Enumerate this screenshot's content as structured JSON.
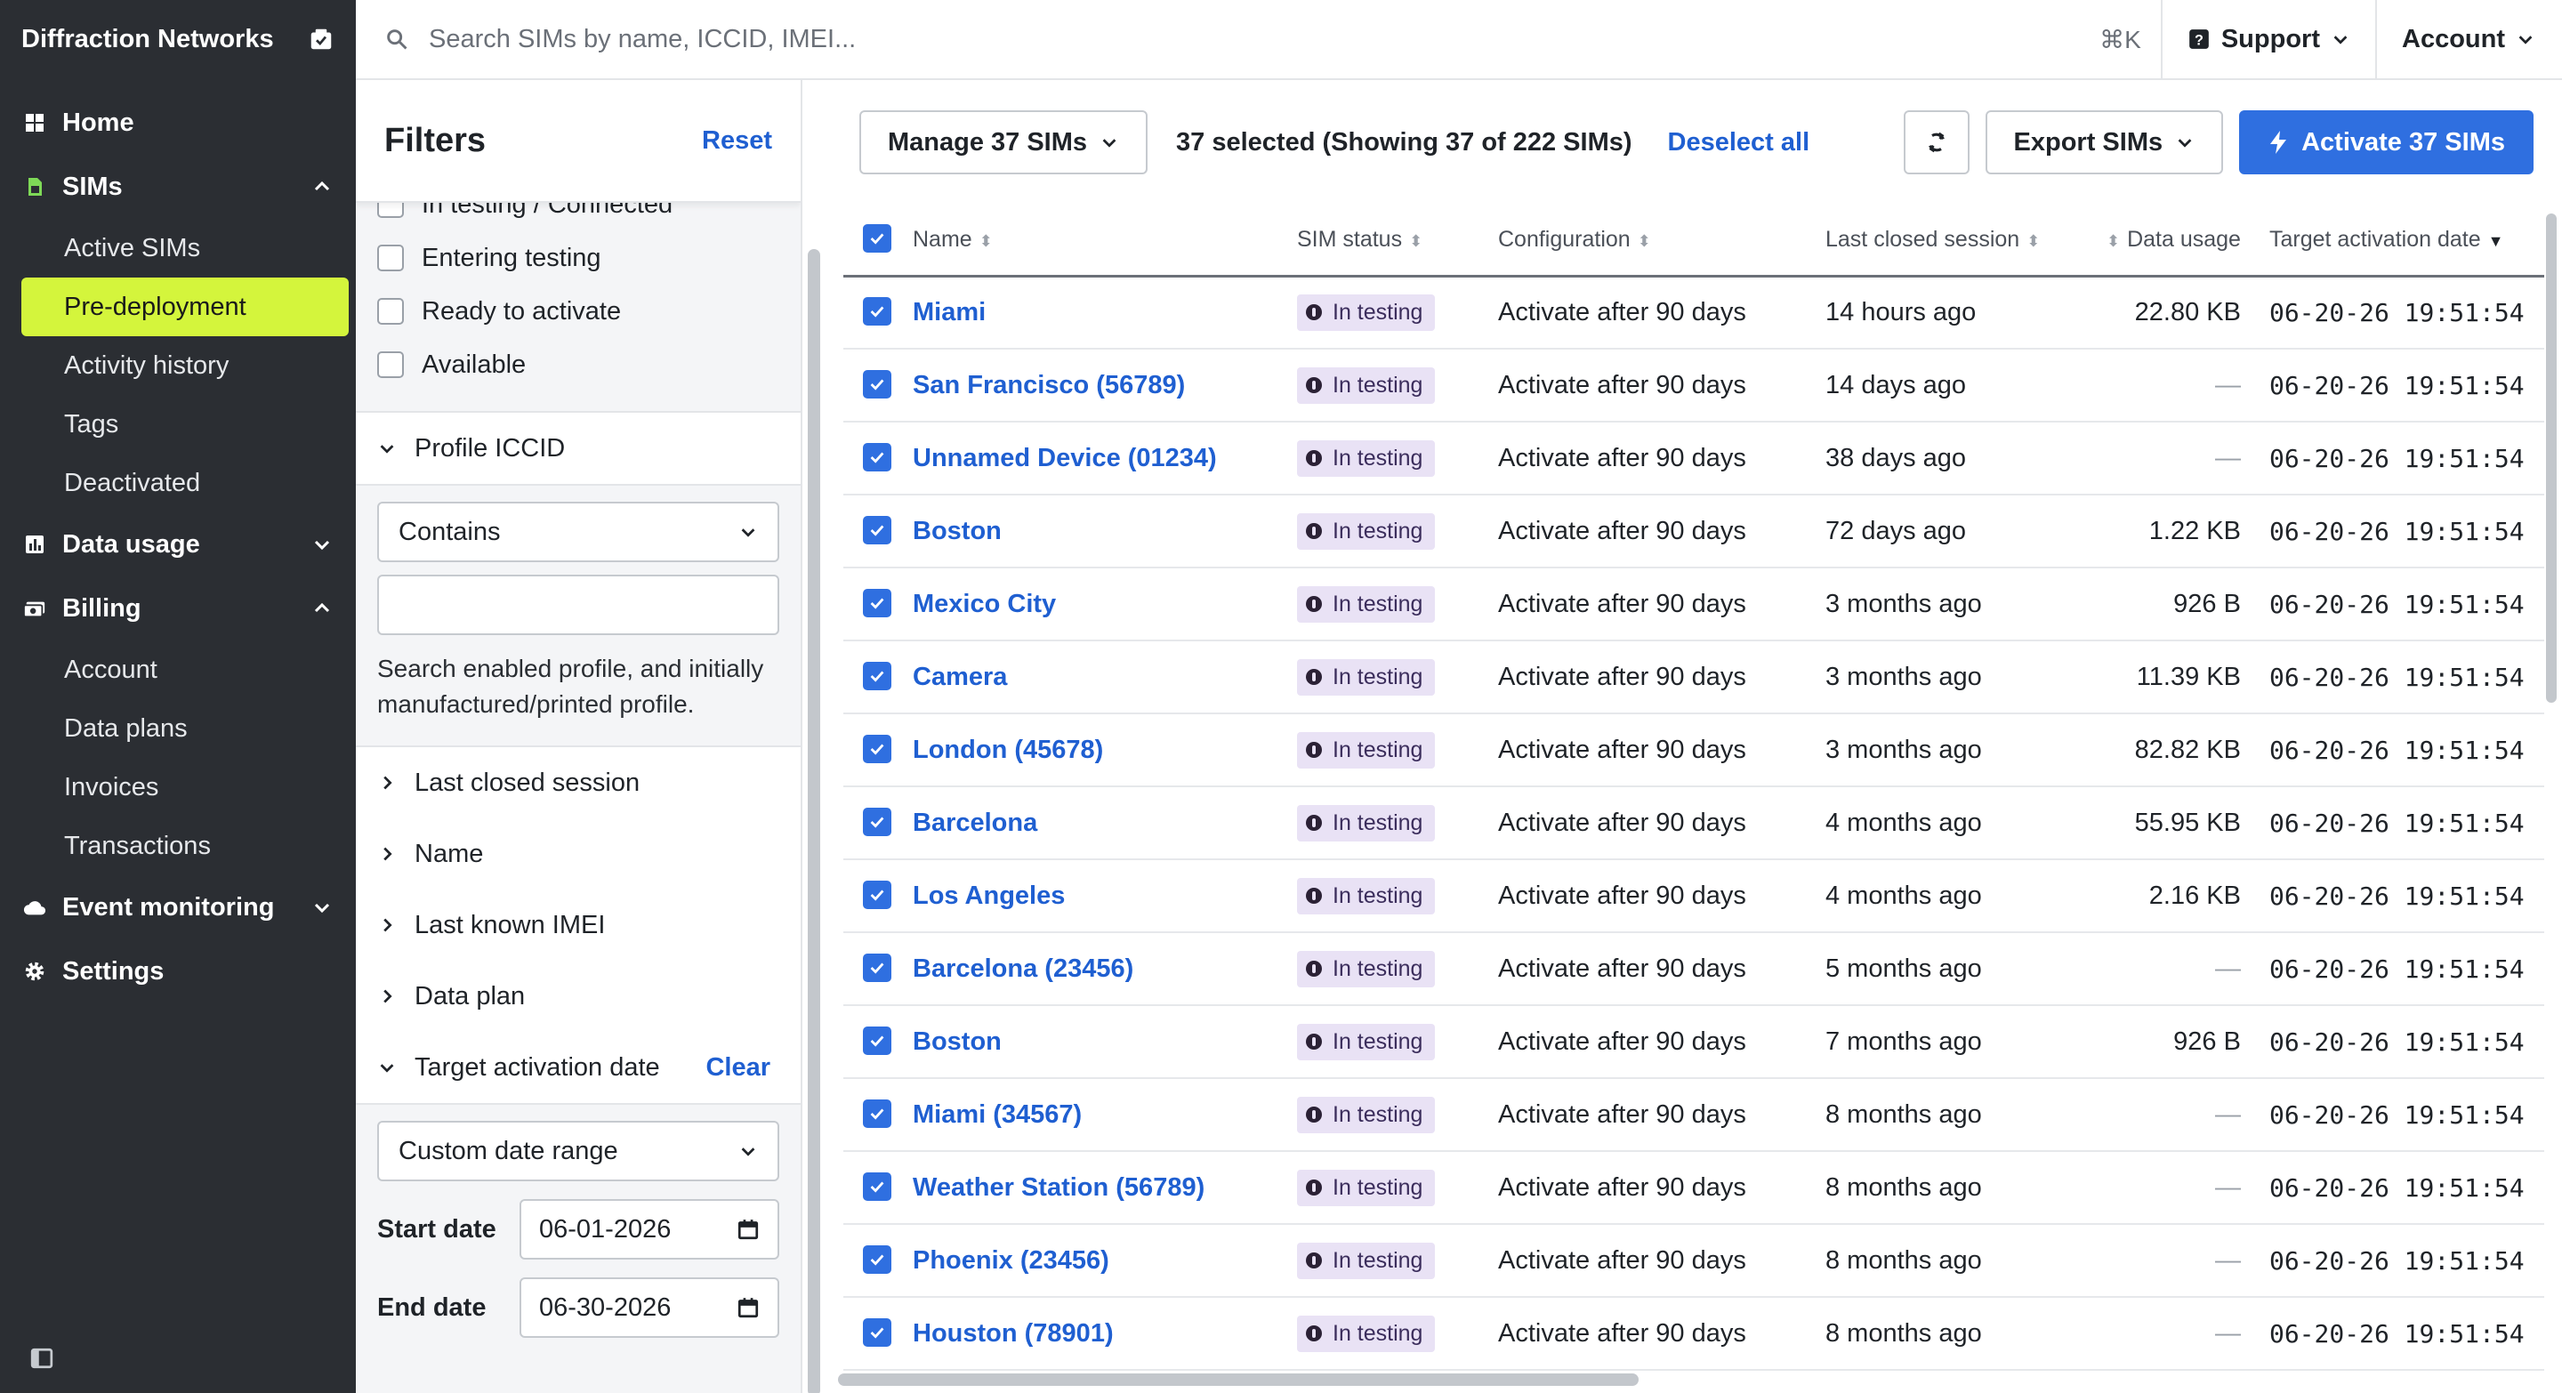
{
  "brand": {
    "name": "Diffraction Networks"
  },
  "nav": {
    "home": "Home",
    "sims": "SIMs",
    "sims_children": [
      "Active SIMs",
      "Pre-deployment",
      "Activity history",
      "Tags",
      "Deactivated"
    ],
    "data_usage": "Data usage",
    "billing": "Billing",
    "billing_children": [
      "Account",
      "Data plans",
      "Invoices",
      "Transactions"
    ],
    "event_monitoring": "Event monitoring",
    "settings": "Settings"
  },
  "topbar": {
    "search_placeholder": "Search SIMs by name, ICCID, IMEI...",
    "shortcut": "⌘K",
    "support": "Support",
    "account": "Account"
  },
  "filters": {
    "title": "Filters",
    "reset": "Reset",
    "status_cut": "In testing / Connected",
    "status_options": [
      "Entering testing",
      "Ready to activate",
      "Available"
    ],
    "profile_iccid": {
      "label": "Profile ICCID",
      "operator": "Contains",
      "value": "",
      "help": "Search enabled profile, and initially manufactured/printed profile."
    },
    "collapsed": [
      "Last closed session",
      "Name",
      "Last known IMEI",
      "Data plan"
    ],
    "target_activation": {
      "label": "Target activation date",
      "clear": "Clear",
      "range": "Custom date range",
      "start_label": "Start date",
      "start_value": "06-01-2026",
      "end_label": "End date",
      "end_value": "06-30-2026"
    }
  },
  "toolbar": {
    "manage": "Manage 37 SIMs",
    "selection": "37 selected (Showing 37 of 222 SIMs)",
    "deselect": "Deselect all",
    "export": "Export SIMs",
    "activate": "Activate 37 SIMs"
  },
  "table": {
    "columns": {
      "name": "Name",
      "status": "SIM status",
      "config": "Configuration",
      "session": "Last closed session",
      "usage": "Data usage",
      "target": "Target activation date"
    },
    "rows": [
      {
        "name": "Miami",
        "status": "In testing",
        "config": "Activate after 90 days",
        "session": "14 hours ago",
        "usage": "22.80 KB",
        "target": "06-20-26 19:51:54"
      },
      {
        "name": "San Francisco (56789)",
        "status": "In testing",
        "config": "Activate after 90 days",
        "session": "14 days ago",
        "usage": "—",
        "target": "06-20-26 19:51:54"
      },
      {
        "name": "Unnamed Device (01234)",
        "status": "In testing",
        "config": "Activate after 90 days",
        "session": "38 days ago",
        "usage": "—",
        "target": "06-20-26 19:51:54"
      },
      {
        "name": "Boston",
        "status": "In testing",
        "config": "Activate after 90 days",
        "session": "72 days ago",
        "usage": "1.22 KB",
        "target": "06-20-26 19:51:54"
      },
      {
        "name": "Mexico City",
        "status": "In testing",
        "config": "Activate after 90 days",
        "session": "3 months ago",
        "usage": "926 B",
        "target": "06-20-26 19:51:54"
      },
      {
        "name": "Camera",
        "status": "In testing",
        "config": "Activate after 90 days",
        "session": "3 months ago",
        "usage": "11.39 KB",
        "target": "06-20-26 19:51:54"
      },
      {
        "name": "London (45678)",
        "status": "In testing",
        "config": "Activate after 90 days",
        "session": "3 months ago",
        "usage": "82.82 KB",
        "target": "06-20-26 19:51:54"
      },
      {
        "name": "Barcelona",
        "status": "In testing",
        "config": "Activate after 90 days",
        "session": "4 months ago",
        "usage": "55.95 KB",
        "target": "06-20-26 19:51:54"
      },
      {
        "name": "Los Angeles",
        "status": "In testing",
        "config": "Activate after 90 days",
        "session": "4 months ago",
        "usage": "2.16 KB",
        "target": "06-20-26 19:51:54"
      },
      {
        "name": "Barcelona (23456)",
        "status": "In testing",
        "config": "Activate after 90 days",
        "session": "5 months ago",
        "usage": "—",
        "target": "06-20-26 19:51:54"
      },
      {
        "name": "Boston",
        "status": "In testing",
        "config": "Activate after 90 days",
        "session": "7 months ago",
        "usage": "926 B",
        "target": "06-20-26 19:51:54"
      },
      {
        "name": "Miami (34567)",
        "status": "In testing",
        "config": "Activate after 90 days",
        "session": "8 months ago",
        "usage": "—",
        "target": "06-20-26 19:51:54"
      },
      {
        "name": "Weather Station (56789)",
        "status": "In testing",
        "config": "Activate after 90 days",
        "session": "8 months ago",
        "usage": "—",
        "target": "06-20-26 19:51:54"
      },
      {
        "name": "Phoenix (23456)",
        "status": "In testing",
        "config": "Activate after 90 days",
        "session": "8 months ago",
        "usage": "—",
        "target": "06-20-26 19:51:54"
      },
      {
        "name": "Houston (78901)",
        "status": "In testing",
        "config": "Activate after 90 days",
        "session": "8 months ago",
        "usage": "—",
        "target": "06-20-26 19:51:54"
      }
    ]
  },
  "colors": {
    "accent": "#2f6fe0",
    "active_nav": "#d4f53c",
    "sidebar_bg": "#2b2e33",
    "badge_bg": "#e9e2f5"
  }
}
